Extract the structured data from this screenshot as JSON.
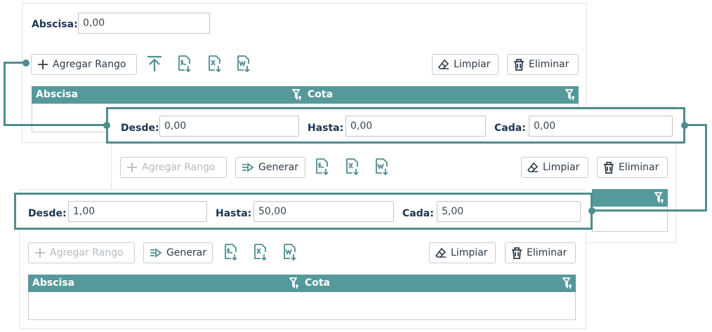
{
  "panel1": {
    "abscisa_label": "Abscisa:",
    "abscisa_value": "0,00",
    "add_range_label": "Agregar Rango",
    "clear_label": "Limpiar",
    "delete_label": "Eliminar",
    "table_headers": [
      "Abscisa",
      "Cota"
    ]
  },
  "callout1": {
    "desde_label": "Desde:",
    "desde_value": "0,00",
    "hasta_label": "Hasta:",
    "hasta_value": "0,00",
    "cada_label": "Cada:",
    "cada_value": "0,00"
  },
  "panel2": {
    "add_range_label": "Agregar Rango",
    "generate_label": "Generar",
    "clear_label": "Limpiar",
    "delete_label": "Eliminar"
  },
  "callout2": {
    "desde_label": "Desde:",
    "desde_value": "1,00",
    "hasta_label": "Hasta:",
    "hasta_value": "50,00",
    "cada_label": "Cada:",
    "cada_value": "5,00"
  },
  "panel3": {
    "add_range_label": "Agregar Rango",
    "generate_label": "Generar",
    "clear_label": "Limpiar",
    "delete_label": "Eliminar",
    "table_headers": [
      "Abscisa",
      "Cota"
    ]
  },
  "colors": {
    "accent": "#55999b",
    "callout": "#4f8d8e",
    "label": "#1b3550"
  },
  "icons": [
    "plus-icon",
    "upload-icon",
    "export-pdf-icon",
    "export-excel-icon",
    "export-word-icon",
    "eraser-icon",
    "trash-icon",
    "generate-icon",
    "filter-icon"
  ]
}
